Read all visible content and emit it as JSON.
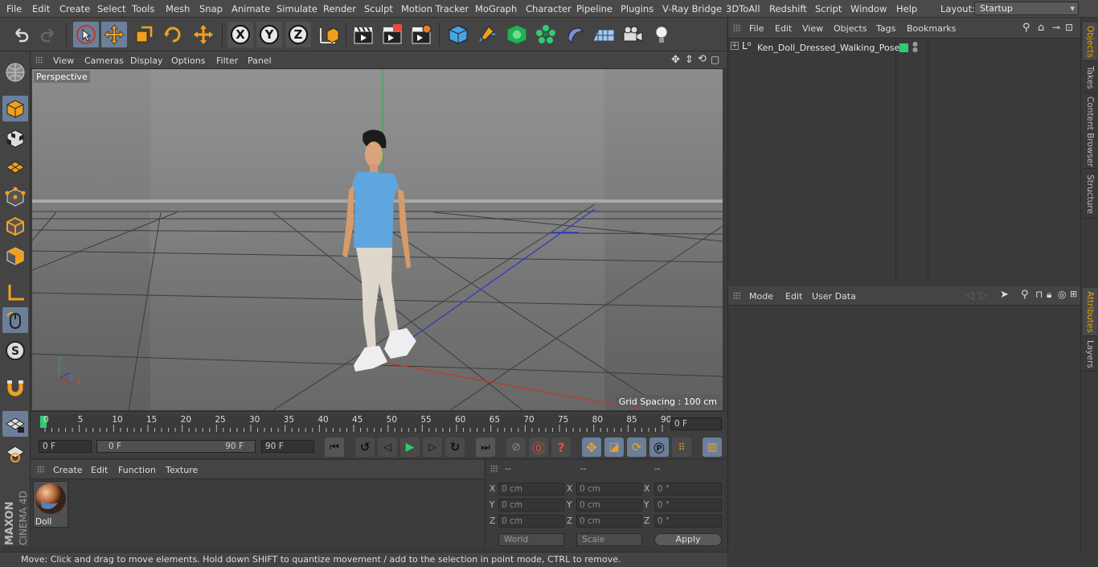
{
  "menubar": {
    "items": [
      "File",
      "Edit",
      "Create",
      "Select",
      "Tools",
      "Mesh",
      "Snap",
      "Animate",
      "Simulate",
      "Render",
      "Sculpt",
      "Motion Tracker",
      "MoGraph",
      "Character",
      "Pipeline",
      "Plugins",
      "V-Ray Bridge",
      "3DToAll",
      "Redshift",
      "Script",
      "Window",
      "Help"
    ],
    "layout_label": "Layout:",
    "layout_value": "Startup"
  },
  "viewport": {
    "menu": [
      "View",
      "Cameras",
      "Display",
      "Options",
      "Filter",
      "Panel"
    ],
    "camera_label": "Perspective",
    "grid_spacing": "Grid Spacing : 100 cm",
    "axis_y": "Y",
    "axis_z": "Z",
    "axis_x": "X"
  },
  "timeline": {
    "ticks": [
      "0",
      "5",
      "10",
      "15",
      "20",
      "25",
      "30",
      "35",
      "40",
      "45",
      "50",
      "55",
      "60",
      "65",
      "70",
      "75",
      "80",
      "85",
      "90"
    ],
    "current_frame": "0 F",
    "start_frame": "0 F",
    "range_start": "0 F",
    "range_end": "90 F",
    "end_frame": "90 F"
  },
  "materials": {
    "menu": [
      "Create",
      "Edit",
      "Function",
      "Texture"
    ],
    "items": [
      {
        "name": "Doll"
      }
    ]
  },
  "coords": {
    "headers": [
      "--",
      "--",
      "--"
    ],
    "rows": [
      {
        "axis": "X",
        "pos": "0 cm",
        "size": "0 cm",
        "rot_axis": "X",
        "rot": "0 °"
      },
      {
        "axis": "Y",
        "pos": "0 cm",
        "size": "0 cm",
        "rot_axis": "Y",
        "rot": "0 °"
      },
      {
        "axis": "Z",
        "pos": "0 cm",
        "size": "0 cm",
        "rot_axis": "Z",
        "rot": "0 °"
      }
    ],
    "size_axes": [
      "X",
      "Y",
      "Z"
    ],
    "mode_world": "World",
    "mode_scale": "Scale",
    "apply": "Apply"
  },
  "objects": {
    "menu": [
      "File",
      "Edit",
      "View",
      "Objects",
      "Tags",
      "Bookmarks"
    ],
    "items": [
      {
        "name": "Ken_Doll_Dressed_Walking_Pose",
        "color": "#2ecc71"
      }
    ]
  },
  "attributes": {
    "menu": [
      "Mode",
      "Edit",
      "User Data"
    ]
  },
  "right_tabs": [
    "Objects",
    "Takes",
    "Content Browser",
    "Structure",
    "Attributes",
    "Layers"
  ],
  "status": "Move: Click and drag to move elements. Hold down SHIFT to quantize movement / add to the selection in point mode, CTRL to remove.",
  "brand": {
    "line1": "MAXON",
    "line2": "CINEMA 4D"
  },
  "colors": {
    "accent": "#e8a400",
    "highlight": "#6b7f9b",
    "object_tag": "#2ecc71"
  }
}
